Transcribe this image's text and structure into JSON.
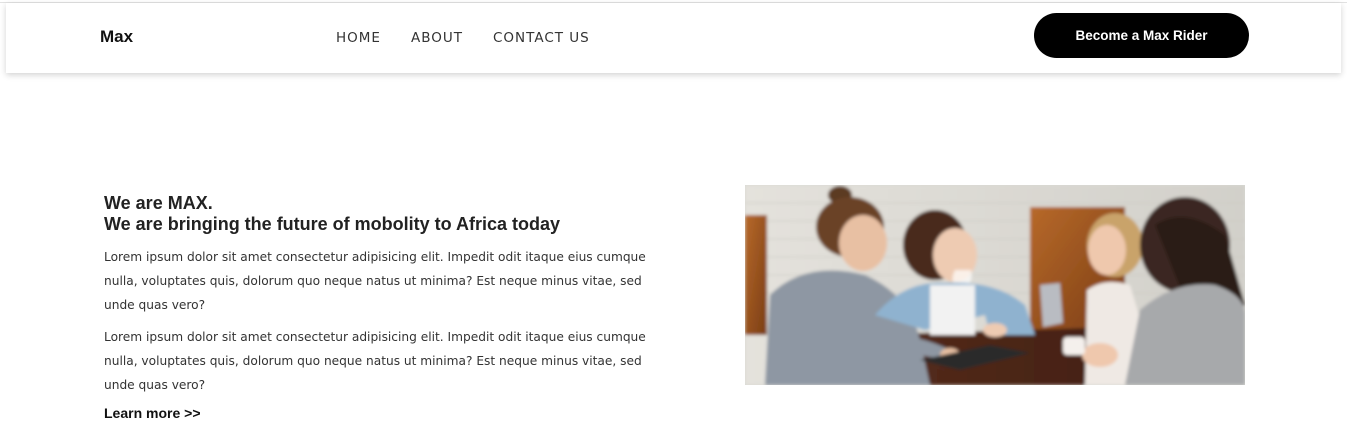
{
  "header": {
    "brand": "Max",
    "nav": [
      {
        "label": "HOME"
      },
      {
        "label": "ABOUT"
      },
      {
        "label": "CONTACT US"
      }
    ],
    "cta_label": "Become a Max Rider"
  },
  "hero": {
    "intro_prefix": "We are ",
    "intro_bold": "MAX.",
    "subtitle": "We are bringing the future of mobolity to Africa today",
    "paragraphs": [
      "Lorem ipsum dolor sit amet consectetur adipisicing elit. Impedit odit itaque eius cumque nulla, voluptates quis, dolorum quo neque natus ut minima? Est neque minus vitae, sed unde quas vero?",
      "Lorem ipsum dolor sit amet consectetur adipisicing elit. Impedit odit itaque eius cumque nulla, voluptates quis, dolorum quo neque natus ut minima? Est neque minus vitae, sed unde quas vero?"
    ],
    "learn_more": "Learn more >>",
    "image_subject": "group-of-friends-at-cafe-table"
  }
}
